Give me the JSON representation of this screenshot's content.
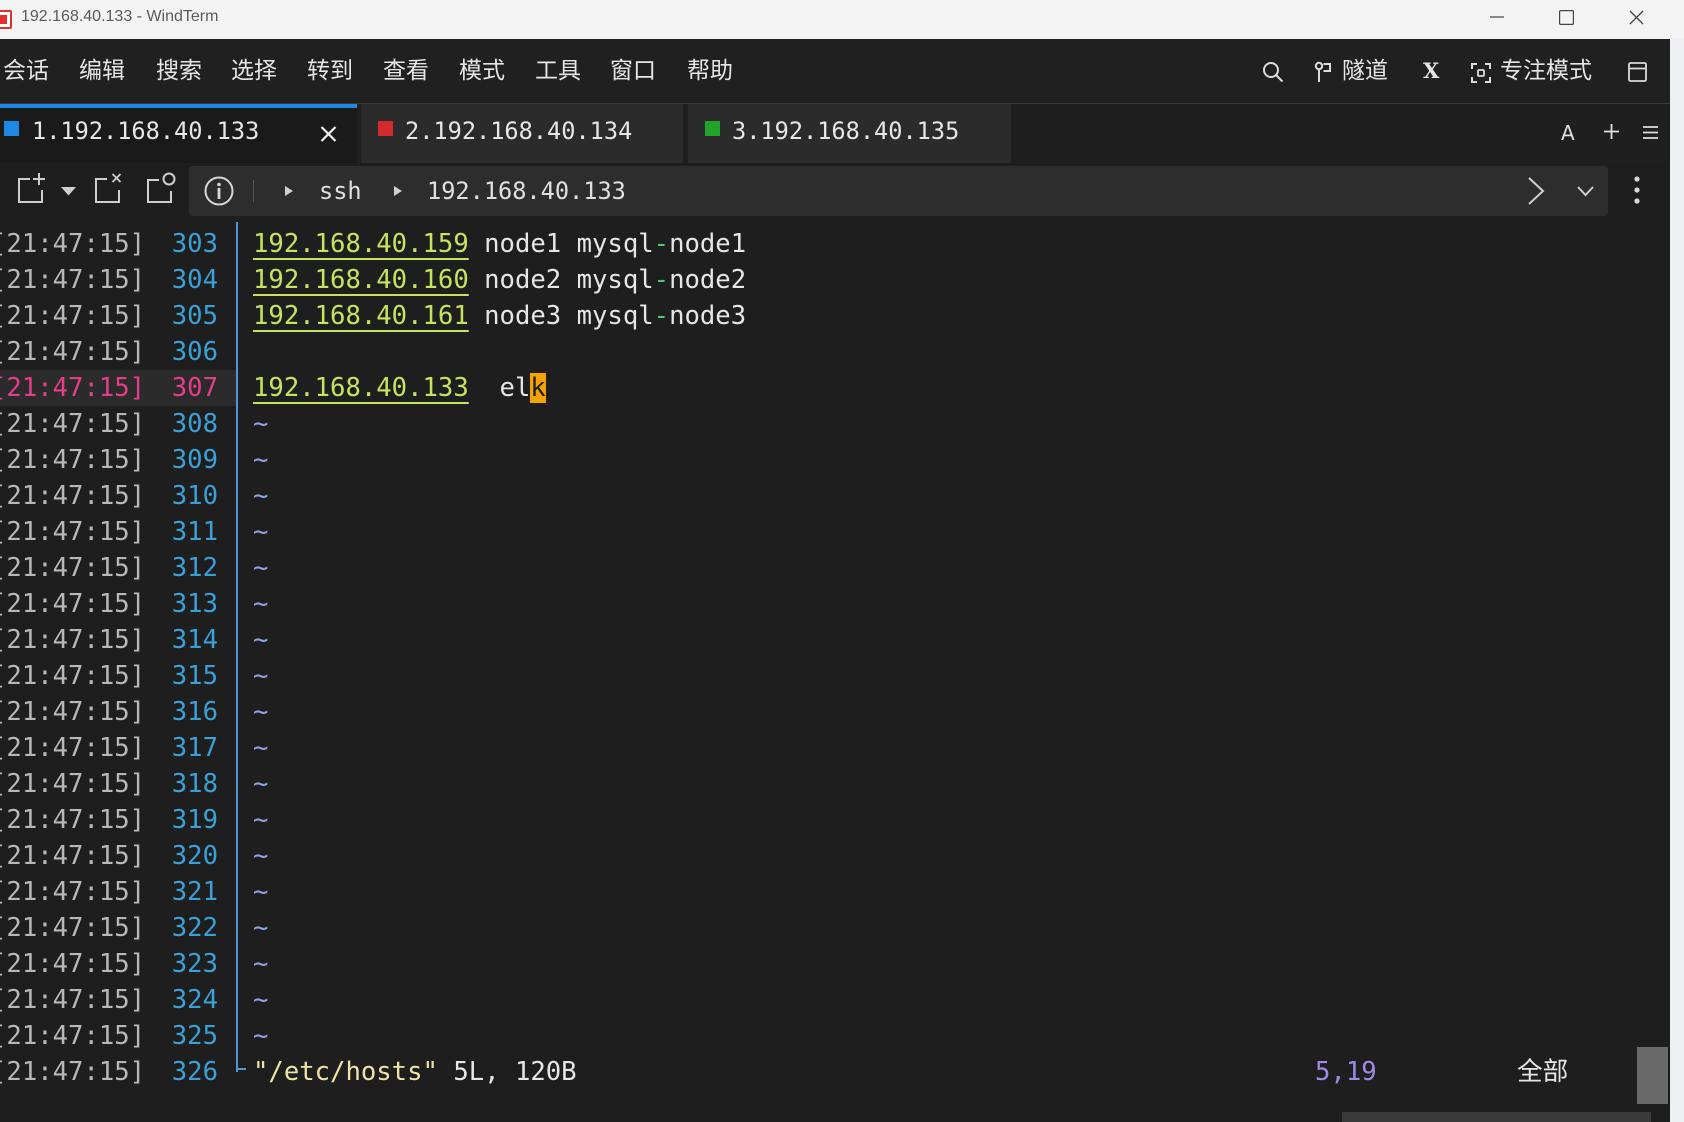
{
  "window": {
    "title": "192.168.40.133 - WindTerm"
  },
  "menu": {
    "items": [
      "会话",
      "编辑",
      "搜索",
      "选择",
      "转到",
      "查看",
      "模式",
      "工具",
      "窗口",
      "帮助"
    ],
    "tunnel": "隧道",
    "x": "X",
    "focus_mode": "专注模式"
  },
  "tabs": [
    {
      "label": "1.192.168.40.133",
      "color": "#1e88e5",
      "active": true
    },
    {
      "label": "2.192.168.40.134",
      "color": "#d12b2b",
      "active": false
    },
    {
      "label": "3.192.168.40.135",
      "color": "#21a32a",
      "active": false
    }
  ],
  "tab_tools": {
    "font": "A"
  },
  "breadcrumb": {
    "protocol": "ssh",
    "host": "192.168.40.133"
  },
  "icons": [
    "app-icon",
    "minimize-icon",
    "maximize-icon",
    "close-icon",
    "search-icon",
    "tunnel-icon",
    "focus-icon",
    "panel-icon",
    "tab-close-icon",
    "plus-icon",
    "menu-icon",
    "new-session-icon",
    "dropdown-icon",
    "close-session-icon",
    "duplicate-session-icon",
    "info-icon",
    "breadcrumb-arrow-icon",
    "chevron-right-icon",
    "chevron-down-icon",
    "more-vertical-icon"
  ],
  "terminal": {
    "colors": {
      "timestamp": "#b8b8b8",
      "line_number": "#3aa0d8",
      "current_line": "#e63c8c",
      "separator": "#4f97d0"
    },
    "lines": [
      {
        "time": "[21:47:15]",
        "num": "303",
        "segments": [
          {
            "text": "192.168.40.159",
            "color": "#c6e35f",
            "underline": true
          },
          {
            "text": " node1 mysql",
            "color": "#e6e6e6"
          },
          {
            "text": "-",
            "color": "#4ec96b"
          },
          {
            "text": "node1",
            "color": "#e6e6e6"
          }
        ]
      },
      {
        "time": "[21:47:15]",
        "num": "304",
        "segments": [
          {
            "text": "192.168.40.160",
            "color": "#c6e35f",
            "underline": true
          },
          {
            "text": " node2 mysql",
            "color": "#e6e6e6"
          },
          {
            "text": "-",
            "color": "#4ec96b"
          },
          {
            "text": "node2",
            "color": "#e6e6e6"
          }
        ]
      },
      {
        "time": "[21:47:15]",
        "num": "305",
        "segments": [
          {
            "text": "192.168.40.161",
            "color": "#c6e35f",
            "underline": true
          },
          {
            "text": " node3 mysql",
            "color": "#e6e6e6"
          },
          {
            "text": "-",
            "color": "#4ec96b"
          },
          {
            "text": "node3",
            "color": "#e6e6e6"
          }
        ]
      },
      {
        "time": "[21:47:15]",
        "num": "306",
        "segments": []
      },
      {
        "time": "[21:47:15]",
        "num": "307",
        "current": true,
        "segments": [
          {
            "text": "192.168.40.133",
            "color": "#c6e35f",
            "underline": true
          },
          {
            "text": "  el",
            "color": "#e6e6e6"
          },
          {
            "text": "k",
            "color": "#1e1e1e",
            "background": "#f5a300",
            "cursor": true
          }
        ]
      },
      {
        "time": "[21:47:15]",
        "num": "308",
        "segments": [
          {
            "text": "~",
            "color": "#8da2e6"
          }
        ]
      },
      {
        "time": "[21:47:15]",
        "num": "309",
        "segments": [
          {
            "text": "~",
            "color": "#8da2e6"
          }
        ]
      },
      {
        "time": "[21:47:15]",
        "num": "310",
        "segments": [
          {
            "text": "~",
            "color": "#8da2e6"
          }
        ]
      },
      {
        "time": "[21:47:15]",
        "num": "311",
        "segments": [
          {
            "text": "~",
            "color": "#8da2e6"
          }
        ]
      },
      {
        "time": "[21:47:15]",
        "num": "312",
        "segments": [
          {
            "text": "~",
            "color": "#8da2e6"
          }
        ]
      },
      {
        "time": "[21:47:15]",
        "num": "313",
        "segments": [
          {
            "text": "~",
            "color": "#8da2e6"
          }
        ]
      },
      {
        "time": "[21:47:15]",
        "num": "314",
        "segments": [
          {
            "text": "~",
            "color": "#8da2e6"
          }
        ]
      },
      {
        "time": "[21:47:15]",
        "num": "315",
        "segments": [
          {
            "text": "~",
            "color": "#8da2e6"
          }
        ]
      },
      {
        "time": "[21:47:15]",
        "num": "316",
        "segments": [
          {
            "text": "~",
            "color": "#8da2e6"
          }
        ]
      },
      {
        "time": "[21:47:15]",
        "num": "317",
        "segments": [
          {
            "text": "~",
            "color": "#8da2e6"
          }
        ]
      },
      {
        "time": "[21:47:15]",
        "num": "318",
        "segments": [
          {
            "text": "~",
            "color": "#8da2e6"
          }
        ]
      },
      {
        "time": "[21:47:15]",
        "num": "319",
        "segments": [
          {
            "text": "~",
            "color": "#8da2e6"
          }
        ]
      },
      {
        "time": "[21:47:15]",
        "num": "320",
        "segments": [
          {
            "text": "~",
            "color": "#8da2e6"
          }
        ]
      },
      {
        "time": "[21:47:15]",
        "num": "321",
        "segments": [
          {
            "text": "~",
            "color": "#8da2e6"
          }
        ]
      },
      {
        "time": "[21:47:15]",
        "num": "322",
        "segments": [
          {
            "text": "~",
            "color": "#8da2e6"
          }
        ]
      },
      {
        "time": "[21:47:15]",
        "num": "323",
        "segments": [
          {
            "text": "~",
            "color": "#8da2e6"
          }
        ]
      },
      {
        "time": "[21:47:15]",
        "num": "324",
        "segments": [
          {
            "text": "~",
            "color": "#8da2e6"
          }
        ]
      },
      {
        "time": "[21:47:15]",
        "num": "325",
        "segments": [
          {
            "text": "~",
            "color": "#8da2e6"
          }
        ]
      },
      {
        "time": "[21:47:15]",
        "num": "326",
        "segments": [
          {
            "text": "\"/etc/hosts\"",
            "color": "#efe3a8"
          },
          {
            "text": " 5L, 120B",
            "color": "#e6e6e6"
          }
        ]
      }
    ],
    "status": {
      "position": "5,19",
      "position_color": "#a08ae8",
      "scope": "全部"
    }
  }
}
